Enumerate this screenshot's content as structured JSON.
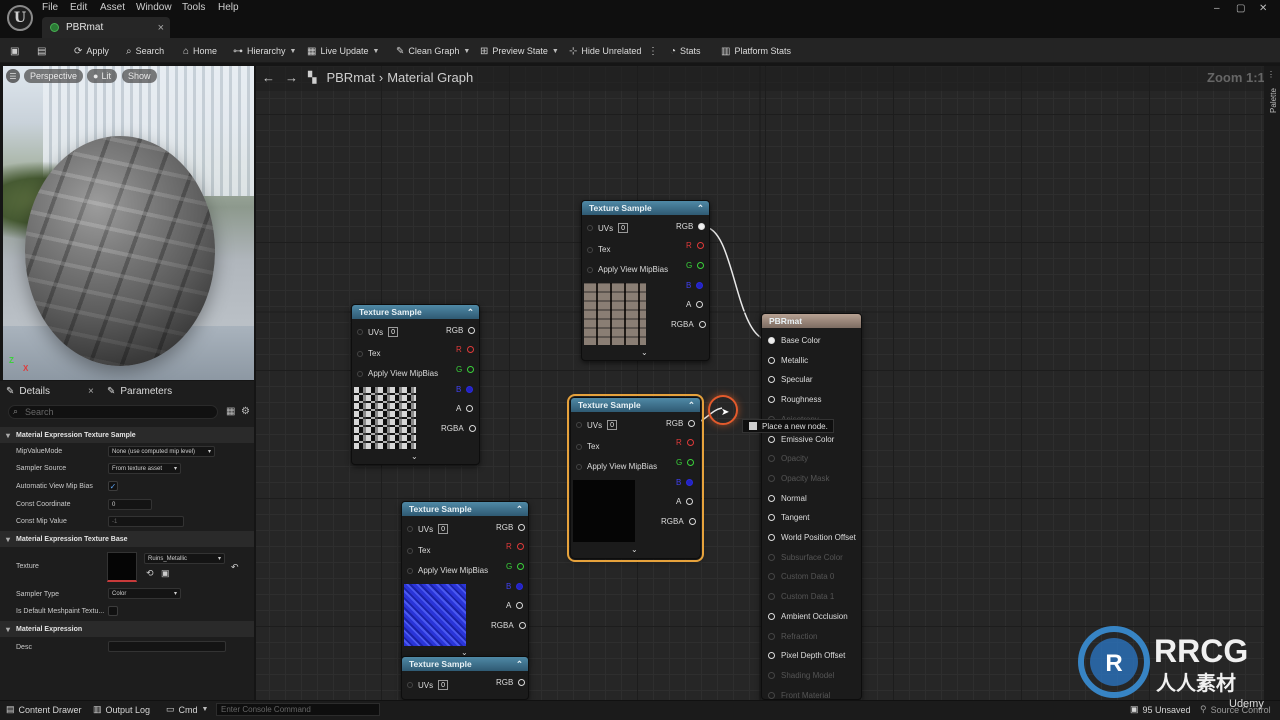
{
  "menu": {
    "items": [
      "File",
      "Edit",
      "Asset",
      "Window",
      "Tools",
      "Help"
    ],
    "logo": "U"
  },
  "tab": {
    "title": "PBRmat",
    "close": "×"
  },
  "window": {
    "minimize": "–",
    "maximize": "▢",
    "close": "✕"
  },
  "toolbar": {
    "apply": "Apply",
    "search": "Search",
    "home": "Home",
    "hierarchy": "Hierarchy",
    "live_update": "Live Update",
    "clean_graph": "Clean Graph",
    "preview_state": "Preview State",
    "hide_unrelated": "Hide Unrelated",
    "stats": "Stats",
    "platform_stats": "Platform Stats"
  },
  "viewport": {
    "perspective": "Perspective",
    "lit": "Lit",
    "show": "Show",
    "axis_z": "Z",
    "axis_x": "X"
  },
  "panel": {
    "details_tab": "Details",
    "parameters_tab": "Parameters",
    "search_placeholder": "Search",
    "sec1": "Material Expression Texture Sample",
    "mip_mode_label": "MipValueMode",
    "mip_mode_value": "None (use computed mip level)",
    "sampler_source_label": "Sampler Source",
    "sampler_source_value": "From texture asset",
    "auto_view_label": "Automatic View Mip Bias",
    "const_coord_label": "Const Coordinate",
    "const_coord_value": "0",
    "const_mip_label": "Const Mip Value",
    "const_mip_value": "-1",
    "sec2": "Material Expression Texture Base",
    "texture_label": "Texture",
    "texture_value": "Ruins_Metallic",
    "sampler_type_label": "Sampler Type",
    "sampler_type_value": "Color",
    "default_mesh_label": "Is Default Meshpaint Textu...",
    "sec3": "Material Expression",
    "desc_label": "Desc"
  },
  "graph": {
    "title": "PBRmat",
    "subtitle": "Material Graph",
    "zoom": "Zoom 1:1",
    "palette": "Palette"
  },
  "node": {
    "title": "Texture Sample",
    "uvs": "UVs",
    "uv_index": "0",
    "tex": "Tex",
    "mipbias": "Apply View MipBias",
    "rgb": "RGB",
    "r": "R",
    "g": "G",
    "b": "B",
    "a": "A",
    "rgba": "RGBA"
  },
  "result": {
    "title": "PBRmat",
    "pins": [
      "Base Color",
      "Metallic",
      "Specular",
      "Roughness",
      "Anisotropy",
      "Emissive Color",
      "Opacity",
      "Opacity Mask",
      "Normal",
      "Tangent",
      "World Position Offset",
      "Subsurface Color",
      "Custom Data 0",
      "Custom Data 1",
      "Ambient Occlusion",
      "Refraction",
      "Pixel Depth Offset",
      "Shading Model",
      "Front Material"
    ]
  },
  "tooltip": {
    "text": "Place a new node."
  },
  "bottom": {
    "content_drawer": "Content Drawer",
    "output_log": "Output Log",
    "cmd": "Cmd",
    "console_placeholder": "Enter Console Command",
    "unsaved": "95 Unsaved",
    "source_control": "Source Control"
  },
  "watermark": {
    "brand": "RRCG",
    "sub": "人人素材",
    "udemy": "Udemy"
  },
  "colors": {
    "accent": "#e6a23c",
    "node_header": "#3d7391",
    "result_header": "#9a8577"
  }
}
